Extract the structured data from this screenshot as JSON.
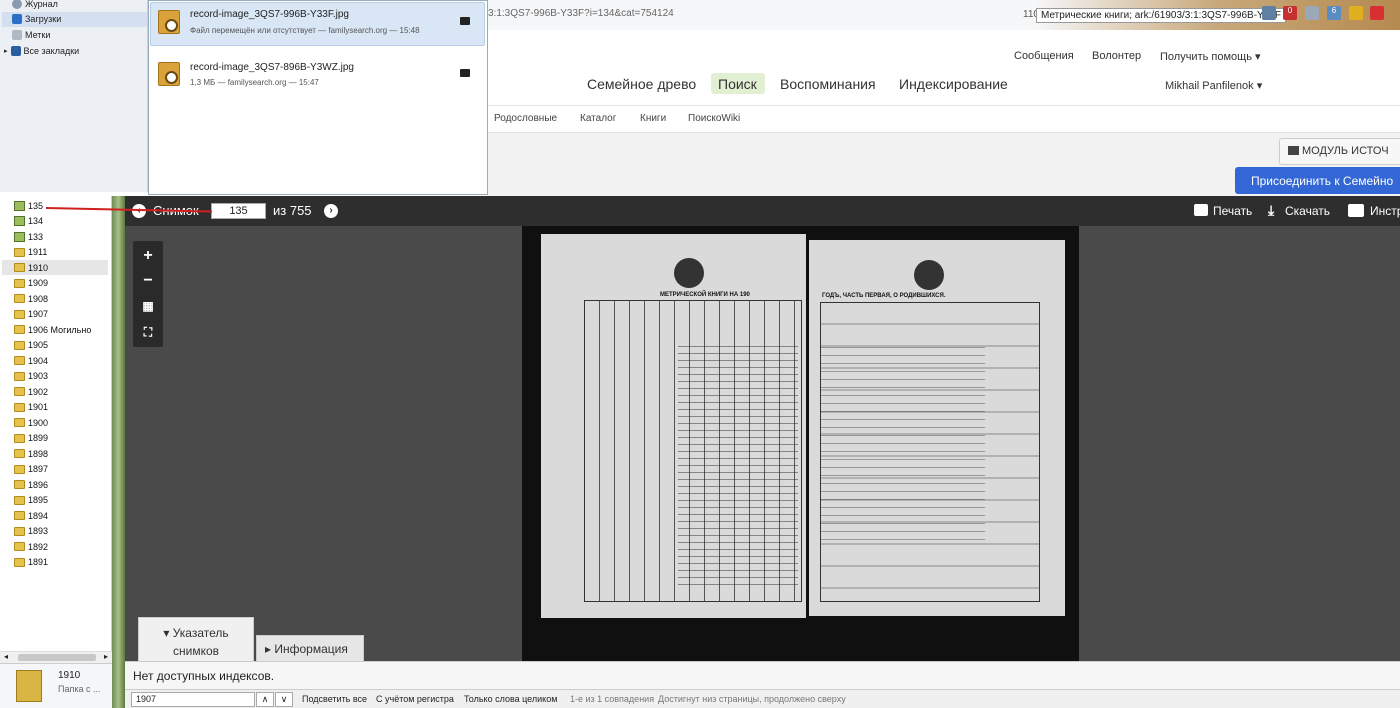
{
  "browser": {
    "url": "3:1:3QS7-996B-Y33F?i=134&cat=754124",
    "tab_count": "110",
    "tooltip": "Метрические книги; ark:/61903/3:1:3QS7-996B-Y33F",
    "badge_count_red": "0",
    "badge_count_blue": "6"
  },
  "library_nav": {
    "items": [
      {
        "label": "Журнал",
        "icon": "history-icon"
      },
      {
        "label": "Загрузки",
        "icon": "download-icon"
      },
      {
        "label": "Метки",
        "icon": "tag-icon"
      },
      {
        "label": "Все закладки",
        "icon": "bookmarks-icon"
      }
    ]
  },
  "downloads": [
    {
      "name": "record-image_3QS7-996B-Y33F.jpg",
      "status": "Файл перемещён или отсутствует — familysearch.org — 15:48"
    },
    {
      "name": "record-image_3QS7-896B-Y3WZ.jpg",
      "status": "1,3 МБ — familysearch.org — 15:47"
    }
  ],
  "site": {
    "top_links": {
      "messages": "Сообщения",
      "volunteer": "Волонтер",
      "help": "Получить помощь ▾"
    },
    "main_nav": {
      "tree": "Семейное древо",
      "search": "Поиск",
      "memories": "Воспоминания",
      "indexing": "Индексирование"
    },
    "user": "Mikhail Panfilenok ▾",
    "sub_nav": {
      "genealogies": "Родословные",
      "catalog": "Каталог",
      "books": "Книги",
      "wiki": "ПоискоWiki"
    },
    "module_button": "МОДУЛЬ ИСТОЧ",
    "join_button": "Присоединить к Семейно"
  },
  "tree": {
    "items": [
      "135",
      "134",
      "133",
      "1911",
      "1910",
      "1909",
      "1908",
      "1907",
      "1906 Могильно",
      "1905",
      "1904",
      "1903",
      "1902",
      "1901",
      "1900",
      "1899",
      "1898",
      "1897",
      "1896",
      "1895",
      "1894",
      "1893",
      "1892",
      "1891"
    ],
    "selected": "1910",
    "folder_info": {
      "name": "1910",
      "type": "Папка с ..."
    }
  },
  "viewer": {
    "image_label": "Снимок",
    "image_number": "135",
    "of_total": "из 755",
    "print": "Печать",
    "download": "Скачать",
    "tools": "Инстр",
    "tab_index": "Указатель снимков",
    "tab_info": "Информация",
    "no_index": "Нет доступных индексов.",
    "doc_header_left": "МЕТРИЧЕСКОЙ КНИГИ НА 190",
    "doc_header_right": "ГОДЪ, ЧАСТЬ ПЕРВАЯ, О РОДИВШИХСЯ."
  },
  "findbar": {
    "query": "1907",
    "highlight_all": "Подсветить все",
    "match_case": "С учётом регистра",
    "whole_words": "Только слова целиком",
    "results": "1-е из 1 совпадения",
    "status": "Достигнут низ страницы, продолжено сверху"
  }
}
